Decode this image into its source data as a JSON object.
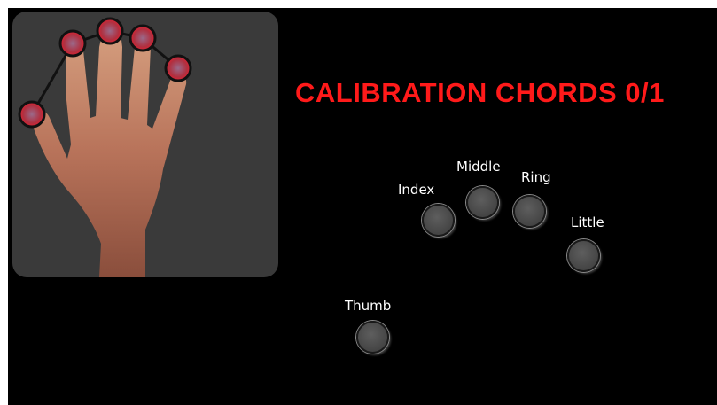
{
  "title": "CALIBRATION CHORDS 0/1",
  "colors": {
    "title": "#ff1a1a",
    "background": "#000000",
    "panel": "#3a3a3a",
    "button": "#4a4a4a",
    "label": "#ffffff",
    "fingertip_marker": "#c0202a"
  },
  "fingers": {
    "index": {
      "label": "Index"
    },
    "middle": {
      "label": "Middle"
    },
    "ring": {
      "label": "Ring"
    },
    "little": {
      "label": "Little"
    },
    "thumb": {
      "label": "Thumb"
    }
  },
  "calibration": {
    "completed": 0,
    "total": 1
  }
}
